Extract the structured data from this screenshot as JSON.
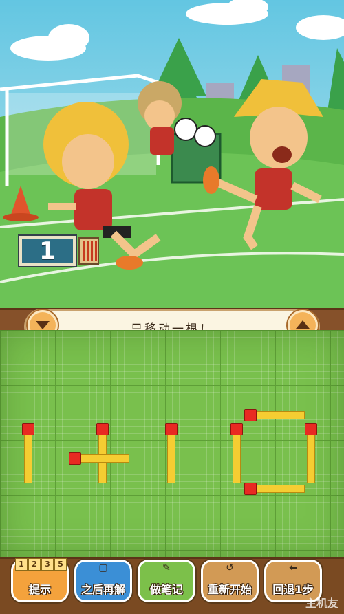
{
  "puzzle": {
    "counter_value": "1",
    "instruction": "只移动一根！"
  },
  "toolbar": {
    "hint": {
      "label": "提示",
      "numbers": [
        "1",
        "2",
        "3",
        "5"
      ]
    },
    "later": {
      "label": "之后再解"
    },
    "notes": {
      "label": "做笔记"
    },
    "restart": {
      "label": "重新开始"
    },
    "undo": {
      "label": "回退1步"
    }
  },
  "watermark": "主机友",
  "colors": {
    "board_green": "#79c04d",
    "match_stick": "#f5cd32",
    "match_head": "#e82a22",
    "banner_bg": "#fbf5e2",
    "wood": "#7a4a22"
  },
  "icons": {
    "scroll_down": "triangle-down-icon",
    "scroll_up": "triangle-up-icon",
    "hint": "number-tiles-icon",
    "later": "bookmark-face-icon",
    "notes": "pencil-icon",
    "restart": "circular-arrow-icon",
    "undo": "left-arrow-icon"
  }
}
